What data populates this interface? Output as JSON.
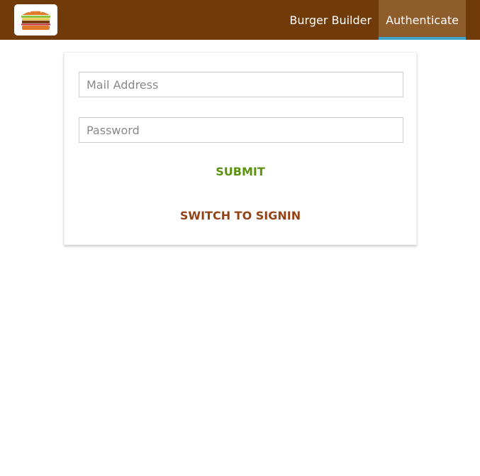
{
  "toolbar": {
    "logo_icon": "burger-logo-icon",
    "colors": {
      "background": "#703B09",
      "active_tab": "#8F5C2C",
      "active_underline": "#40A4C8"
    },
    "nav": [
      {
        "label": "Burger Builder",
        "active": false
      },
      {
        "label": "Authenticate",
        "active": true
      }
    ]
  },
  "auth_form": {
    "email": {
      "value": "",
      "placeholder": "Mail Address"
    },
    "password": {
      "value": "",
      "placeholder": "Password"
    },
    "submit_label": "SUBMIT",
    "switch_label": "SWITCH TO SIGNIN",
    "colors": {
      "submit": "#5C9210",
      "switch": "#944317"
    }
  }
}
